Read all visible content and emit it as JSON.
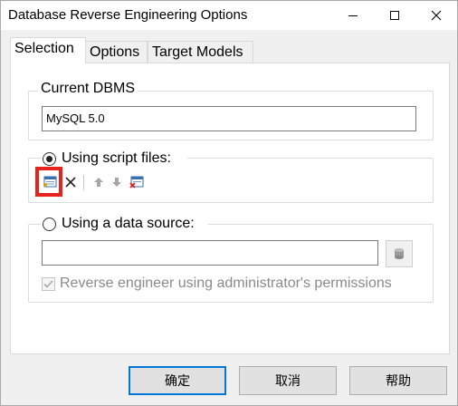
{
  "window": {
    "title": "Database Reverse Engineering Options",
    "controls": {
      "minimize_icon": "minimize-icon",
      "maximize_icon": "maximize-icon",
      "close_icon": "close-icon"
    }
  },
  "tabs": [
    {
      "label": "Selection",
      "active": true
    },
    {
      "label": "Options",
      "active": false
    },
    {
      "label": "Target Models",
      "active": false
    }
  ],
  "dbms": {
    "group_label": "Current DBMS",
    "value": "MySQL 5.0"
  },
  "script_files": {
    "radio_label": "Using script files:",
    "selected": true,
    "toolbar": [
      "add-files-icon",
      "delete-icon",
      "move-up-icon",
      "move-down-icon",
      "clear-all-icon"
    ]
  },
  "data_source": {
    "radio_label": "Using a data source:",
    "selected": false,
    "value": "",
    "permissions_label": "Reverse engineer using administrator's permissions",
    "permissions_checked": true,
    "permissions_enabled": false
  },
  "buttons": {
    "ok": "确定",
    "cancel": "取消",
    "help": "帮助"
  },
  "colors": {
    "highlight": "#e8211b",
    "default_button_border": "#0078d7"
  }
}
